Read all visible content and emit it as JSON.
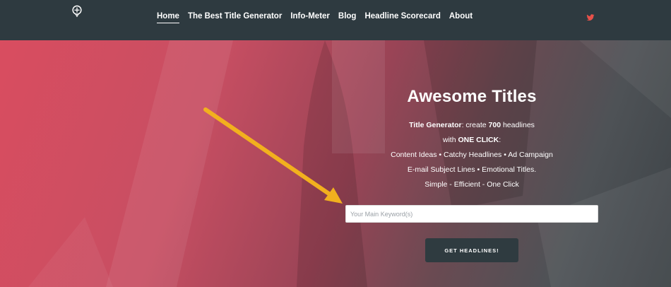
{
  "header": {
    "nav": [
      {
        "label": "Home"
      },
      {
        "label": "The Best Title Generator"
      },
      {
        "label": "Info-Meter"
      },
      {
        "label": "Blog"
      },
      {
        "label": "Headline Scorecard"
      },
      {
        "label": "About"
      }
    ],
    "logo_icon": "brain-bulb-icon",
    "social_icon": "twitter-icon",
    "accent_color": "#e8514a"
  },
  "hero": {
    "title": "Awesome Titles",
    "line1_strong": "Title Generator",
    "line1_text": ": create ",
    "line1_count": "700",
    "line1_tail": " headlines",
    "line2_text": "with ",
    "line2_strong": "ONE CLICK",
    "line2_tail": ":",
    "line3": "Content Ideas • Catchy Headlines • Ad Campaign",
    "line4": "E-mail Subject Lines • Emotional Titles.",
    "line5": "Simple - Efficient - One Click",
    "input_placeholder": "Your Main Keyword(s)",
    "input_value": "",
    "button_label": "GET HEADLINES!"
  }
}
